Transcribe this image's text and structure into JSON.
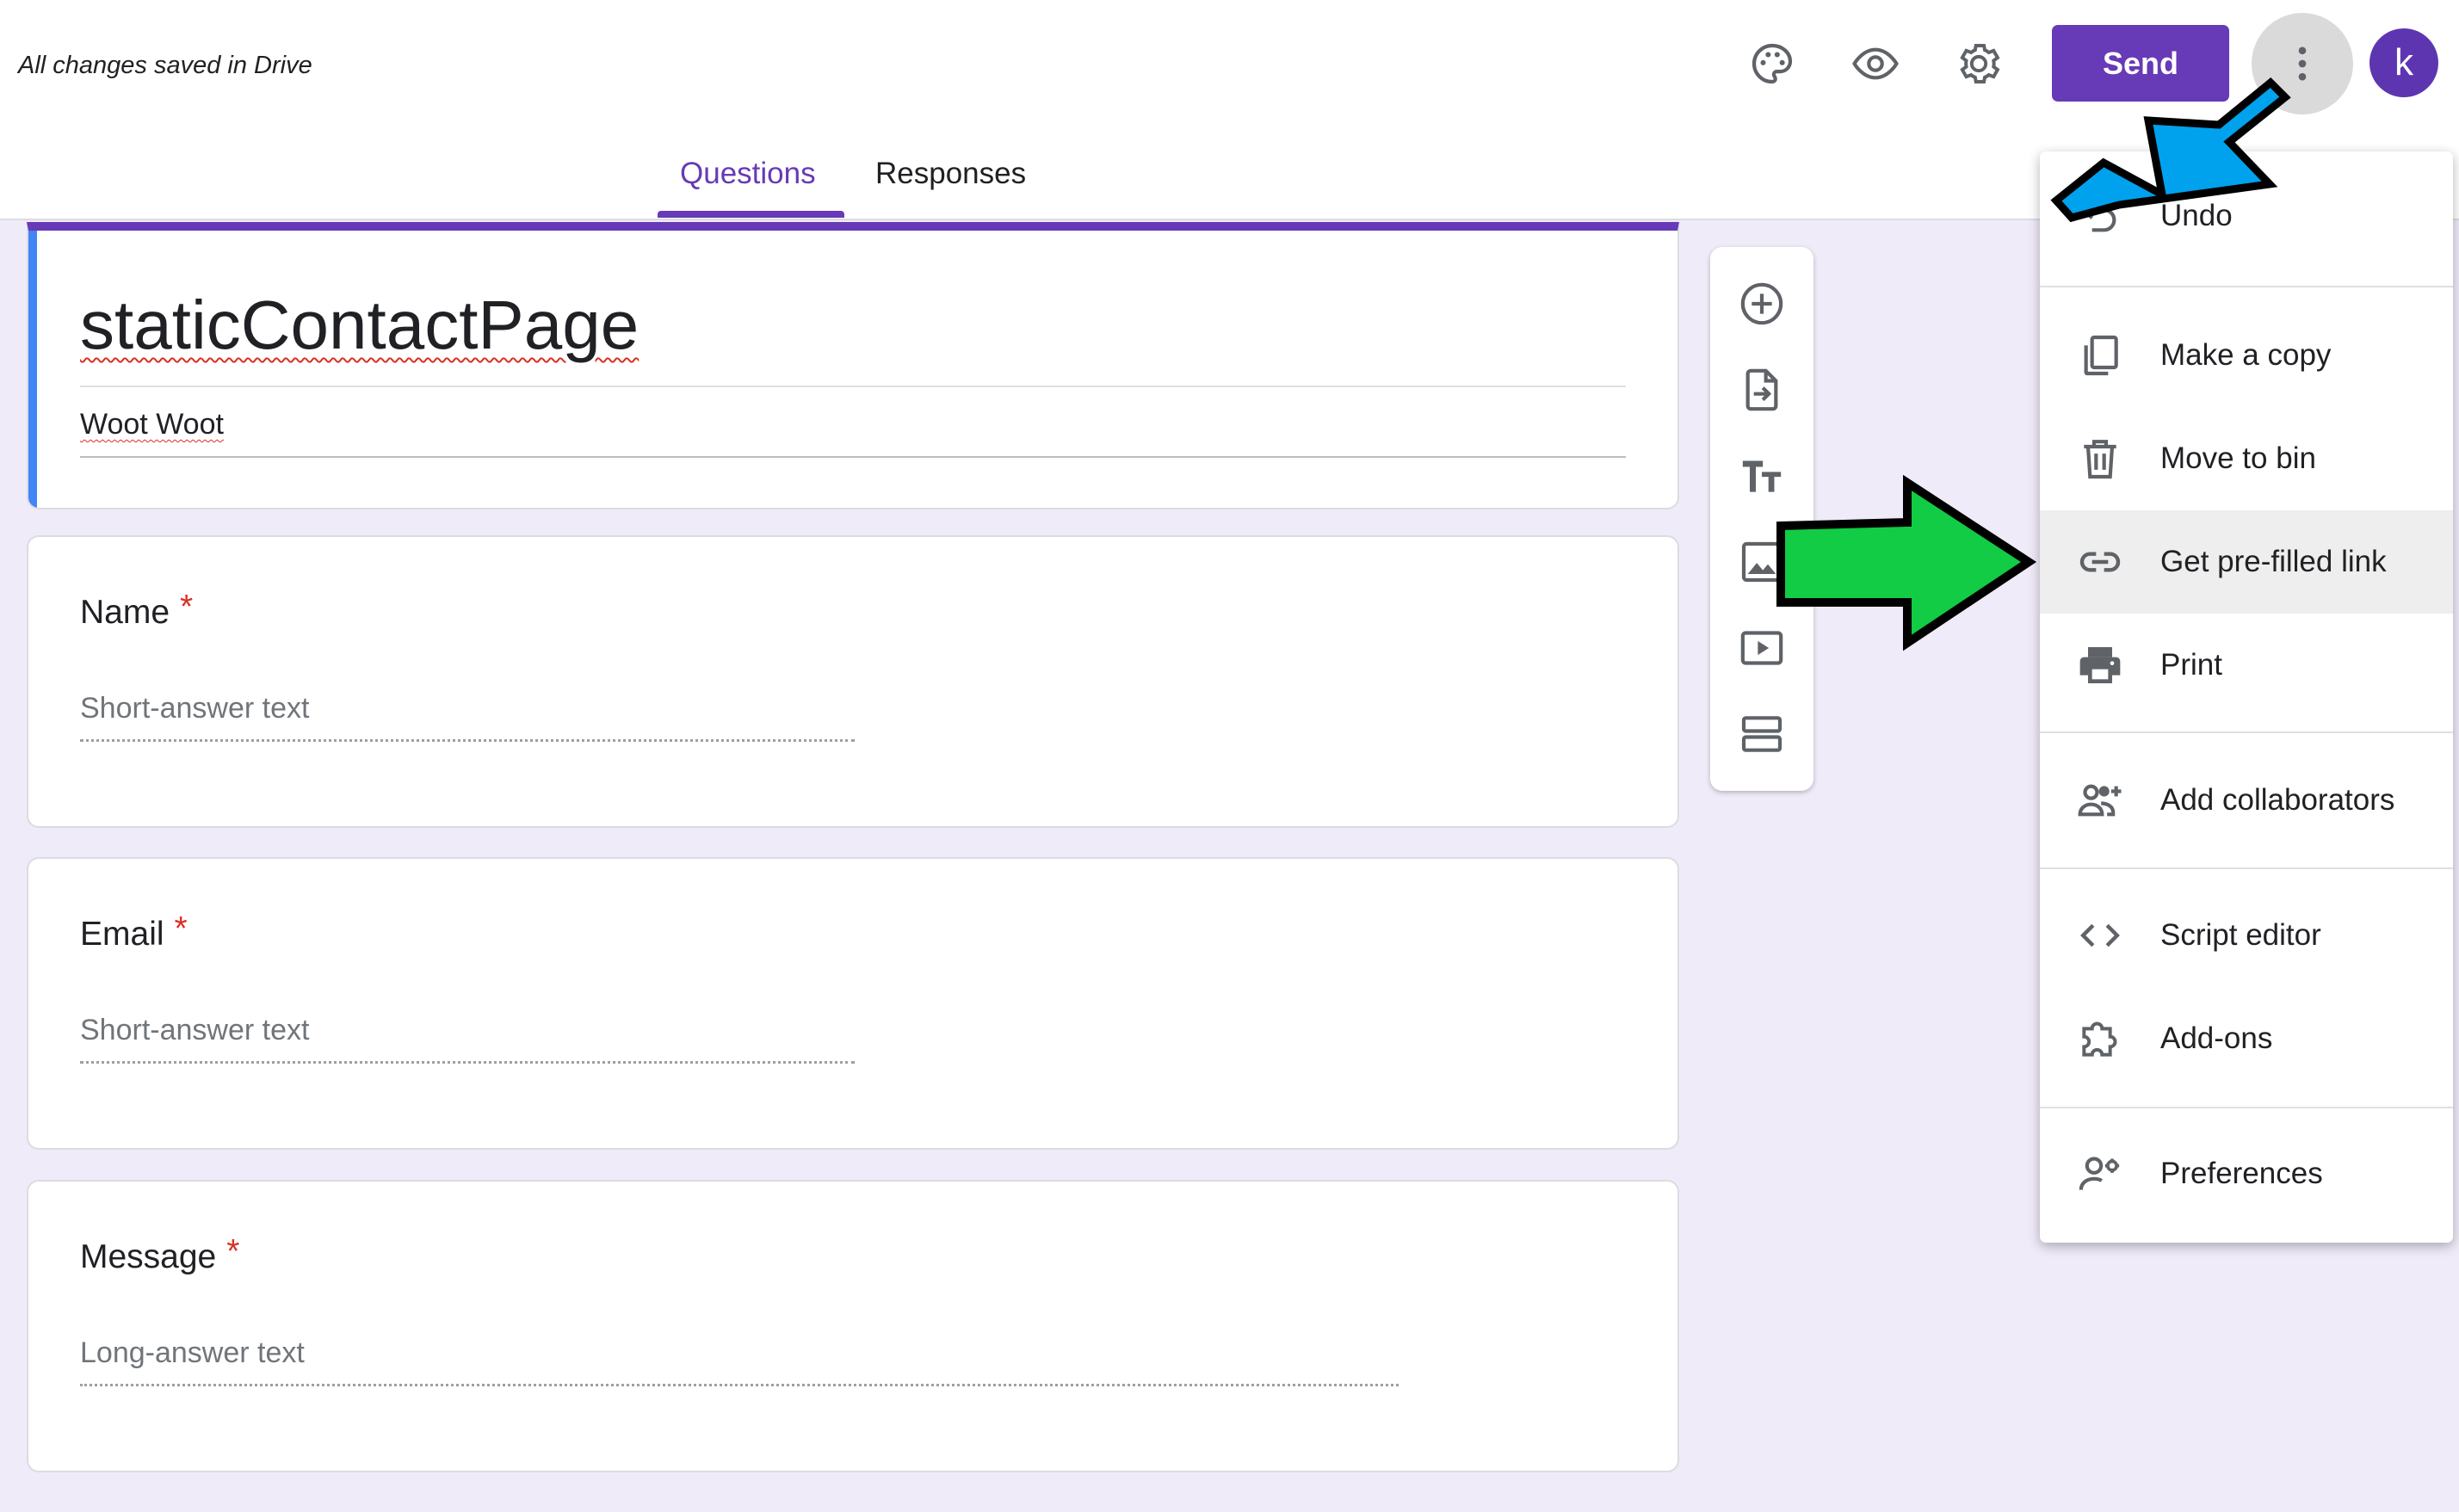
{
  "header": {
    "saved_status": "All changes saved in Drive",
    "send_label": "Send",
    "avatar_letter": "k",
    "tabs": [
      {
        "label": "Questions",
        "active": true
      },
      {
        "label": "Responses",
        "active": false
      }
    ],
    "accent_color": "#673ab7"
  },
  "form": {
    "title": "staticContactPage",
    "description": "Woot Woot",
    "questions": [
      {
        "label": "Name",
        "required_mark": "*",
        "placeholder": "Short-answer text"
      },
      {
        "label": "Email",
        "required_mark": "*",
        "placeholder": "Short-answer text"
      },
      {
        "label": "Message",
        "required_mark": "*",
        "placeholder": "Long-answer text"
      }
    ]
  },
  "toolbar": {
    "icons": [
      "add-question-icon",
      "import-questions-icon",
      "add-title-icon",
      "add-image-icon",
      "add-video-icon",
      "add-section-icon"
    ]
  },
  "menu": {
    "items": [
      {
        "label": "Undo",
        "icon": "undo-icon"
      },
      {
        "label": "Make a copy",
        "icon": "copy-icon"
      },
      {
        "label": "Move to bin",
        "icon": "trash-icon"
      },
      {
        "label": "Get pre-filled link",
        "icon": "link-icon",
        "highlighted": true
      },
      {
        "label": "Print",
        "icon": "print-icon"
      },
      {
        "label": "Add collaborators",
        "icon": "add-people-icon"
      },
      {
        "label": "Script editor",
        "icon": "code-icon"
      },
      {
        "label": "Add-ons",
        "icon": "puzzle-icon"
      },
      {
        "label": "Preferences",
        "icon": "preferences-icon"
      }
    ]
  },
  "annotations": {
    "blue_arrow_color": "#00a2ed",
    "green_arrow_color": "#11cc44"
  }
}
